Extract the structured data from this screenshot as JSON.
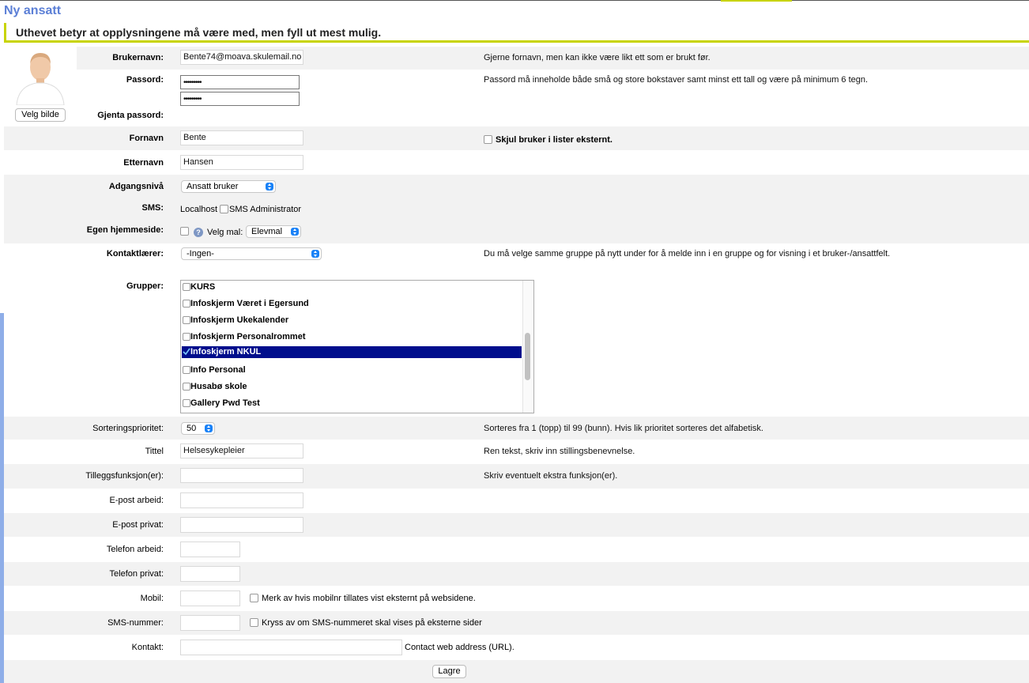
{
  "page": {
    "title": "Ny ansatt",
    "subtitle": "Uthevet betyr at opplysningene må være med, men fyll ut mest mulig."
  },
  "avatar": {
    "button_label": "Velg bilde"
  },
  "fields": {
    "username": {
      "label": "Brukernavn:",
      "value": "Bente74@moava.skulemail.no",
      "help": "Gjerne fornavn, men kan ikke være likt ett som er brukt før."
    },
    "password": {
      "label": "Passord:",
      "value": "•••••••••",
      "help": "Passord må inneholde både små og store bokstaver samt minst ett tall og være på minimum 6 tegn."
    },
    "password_repeat": {
      "label": "Gjenta passord:",
      "value": "•••••••••"
    },
    "firstname": {
      "label": "Fornavn",
      "value": "Bente",
      "hide_label": "Skjul bruker i lister eksternt."
    },
    "lastname": {
      "label": "Etternavn",
      "value": "Hansen"
    },
    "access_level": {
      "label": "Adgangsnivå",
      "value": "Ansatt bruker"
    },
    "sms": {
      "label": "SMS:",
      "value": "Localhost",
      "admin_label": "SMS Administrator"
    },
    "homepage": {
      "label": "Egen hjemmeside:",
      "template_label": "Velg mal:",
      "template_value": "Elevmal"
    },
    "contact_teacher": {
      "label": "Kontaktlærer:",
      "value": "-Ingen-",
      "help": "Du må velge samme gruppe på nytt under for å melde inn i en gruppe og for visning i et bruker-/ansattfelt."
    },
    "groups": {
      "label": "Grupper:",
      "items": [
        {
          "name": "KURS",
          "checked": false
        },
        {
          "name": "Infoskjerm Været i Egersund",
          "checked": false
        },
        {
          "name": "Infoskjerm Ukekalender",
          "checked": false
        },
        {
          "name": "Infoskjerm Personalrommet",
          "checked": false
        },
        {
          "name": "Infoskjerm NKUL",
          "checked": true
        },
        {
          "name": "Info Personal",
          "checked": false
        },
        {
          "name": "Husabø skole",
          "checked": false
        },
        {
          "name": "Gallery Pwd Test",
          "checked": false
        }
      ]
    },
    "sort_priority": {
      "label": "Sorteringsprioritet:",
      "value": "50",
      "help": "Sorteres fra 1 (topp) til 99 (bunn). Hvis lik prioritet sorteres det alfabetisk."
    },
    "title": {
      "label": "Tittel",
      "value": "Helsesykepleier",
      "help": "Ren tekst, skriv inn stillingsbenevnelse."
    },
    "extra_functions": {
      "label": "Tilleggsfunksjon(er):",
      "value": "",
      "help": "Skriv eventuelt ekstra funksjon(er)."
    },
    "email_work": {
      "label": "E-post arbeid:",
      "value": ""
    },
    "email_private": {
      "label": "E-post privat:",
      "value": ""
    },
    "phone_work": {
      "label": "Telefon arbeid:",
      "value": ""
    },
    "phone_private": {
      "label": "Telefon privat:",
      "value": ""
    },
    "mobile": {
      "label": "Mobil:",
      "value": "",
      "check_label": "Merk av hvis mobilnr tillates vist eksternt på websidene."
    },
    "sms_number": {
      "label": "SMS-nummer:",
      "value": "",
      "check_label": "Kryss av om SMS-nummeret skal vises på eksterne sider"
    },
    "contact": {
      "label": "Kontakt:",
      "value": "",
      "help": "Contact web address (URL)."
    }
  },
  "actions": {
    "save_label": "Lagre"
  },
  "colors": {
    "accent": "#c8d400",
    "title": "#5b7fd6",
    "selection": "#000e8c",
    "select_arrow": "#1a82f7"
  },
  "icons": {
    "help": "question-circle-icon",
    "avatar": "person-silhouette-icon"
  }
}
